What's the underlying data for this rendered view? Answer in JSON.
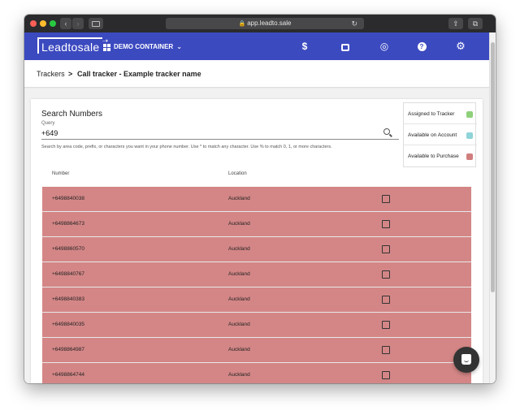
{
  "browser": {
    "url": "app.leadto.sale",
    "back_glyph": "‹",
    "forward_glyph": "›",
    "reload_glyph": "↻",
    "share_glyph": "⇪",
    "tabs_glyph": "⧉",
    "new_tab_glyph": "+"
  },
  "header": {
    "logo_text": "Leadtosale",
    "container_label": "DEMO CONTAINER",
    "brand_color": "#3c4ac0",
    "icons": [
      "dollar-icon",
      "inbox-icon",
      "target-icon",
      "help-icon",
      "gear-icon"
    ],
    "dollar_glyph": "$",
    "help_glyph": "?",
    "target_glyph": "◎",
    "gear_glyph": "⚙",
    "chevron_glyph": "⌄"
  },
  "breadcrumb": {
    "root": "Trackers",
    "separator": ">",
    "current": "Call tracker - Example tracker name"
  },
  "search": {
    "title": "Search Numbers",
    "query_label": "Query",
    "query_value": "+649",
    "hint": "Search by area code, prefix, or characters you want in your phone number. Use * to match any character. Use % to match 0, 1, or more characters."
  },
  "legend": [
    {
      "label": "Assigned to Tracker",
      "color": "#8fd07a"
    },
    {
      "label": "Available on Account",
      "color": "#8ed4d8"
    },
    {
      "label": "Available to Purchase",
      "color": "#d17e7e"
    }
  ],
  "table": {
    "columns": {
      "number": "Number",
      "location": "Location"
    },
    "row_color": "#d48686",
    "rows": [
      {
        "number": "+6498840038",
        "location": "Auckland"
      },
      {
        "number": "+6498864673",
        "location": "Auckland"
      },
      {
        "number": "+6498860570",
        "location": "Auckland"
      },
      {
        "number": "+6498840767",
        "location": "Auckland"
      },
      {
        "number": "+6498840383",
        "location": "Auckland"
      },
      {
        "number": "+6498840035",
        "location": "Auckland"
      },
      {
        "number": "+6498864987",
        "location": "Auckland"
      },
      {
        "number": "+6498864744",
        "location": "Auckland"
      }
    ]
  }
}
